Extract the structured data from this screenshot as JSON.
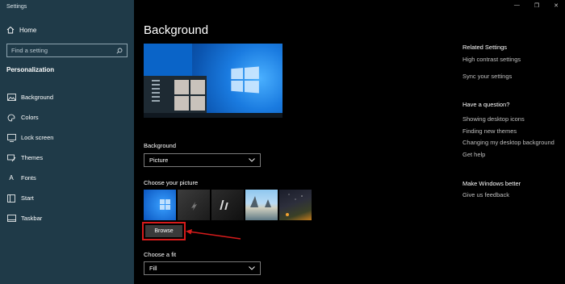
{
  "sidebar": {
    "app_title": "Settings",
    "home": "Home",
    "search_placeholder": "Find a setting",
    "section_title": "Personalization",
    "items": [
      {
        "label": "Background",
        "icon": "picture-icon"
      },
      {
        "label": "Colors",
        "icon": "palette-icon"
      },
      {
        "label": "Lock screen",
        "icon": "monitor-icon"
      },
      {
        "label": "Themes",
        "icon": "brush-icon"
      },
      {
        "label": "Fonts",
        "icon": "font-icon"
      },
      {
        "label": "Start",
        "icon": "start-grid-icon"
      },
      {
        "label": "Taskbar",
        "icon": "taskbar-icon"
      }
    ]
  },
  "window": {
    "minimize": "—",
    "maximize": "❐",
    "close": "✕"
  },
  "main": {
    "title": "Background",
    "background_label": "Background",
    "background_value": "Picture",
    "choose_picture_label": "Choose your picture",
    "browse_label": "Browse",
    "fit_label": "Choose a fit",
    "fit_value": "Fill"
  },
  "related": {
    "title": "Related Settings",
    "links": [
      "High contrast settings",
      "Sync your settings"
    ]
  },
  "question": {
    "title": "Have a question?",
    "links": [
      "Showing desktop icons",
      "Finding new themes",
      "Changing my desktop background",
      "Get help"
    ]
  },
  "better": {
    "title": "Make Windows better",
    "links": [
      "Give us feedback"
    ]
  },
  "annotation": {
    "color": "#d61b1b"
  }
}
